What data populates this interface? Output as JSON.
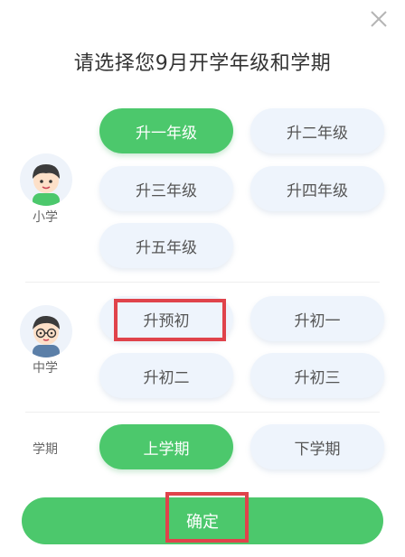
{
  "dialog": {
    "title": "请选择您9月开学年级和学期",
    "close_icon": "close-icon"
  },
  "primary": {
    "label": "小学",
    "avatar_icon": "boy-avatar-icon",
    "options": [
      "升一年级",
      "升二年级",
      "升三年级",
      "升四年级",
      "升五年级"
    ],
    "selected": "升一年级"
  },
  "middle": {
    "label": "中学",
    "avatar_icon": "boy-with-glasses-avatar-icon",
    "options": [
      "升预初",
      "升初一",
      "升初二",
      "升初三"
    ],
    "highlighted": "升预初"
  },
  "term": {
    "label": "学期",
    "options": [
      "上学期",
      "下学期"
    ],
    "selected": "上学期"
  },
  "confirm_label": "确定",
  "colors": {
    "accent_green": "#4cc86c",
    "pill_bg": "#eef4fc",
    "highlight_red": "#e0434b"
  }
}
